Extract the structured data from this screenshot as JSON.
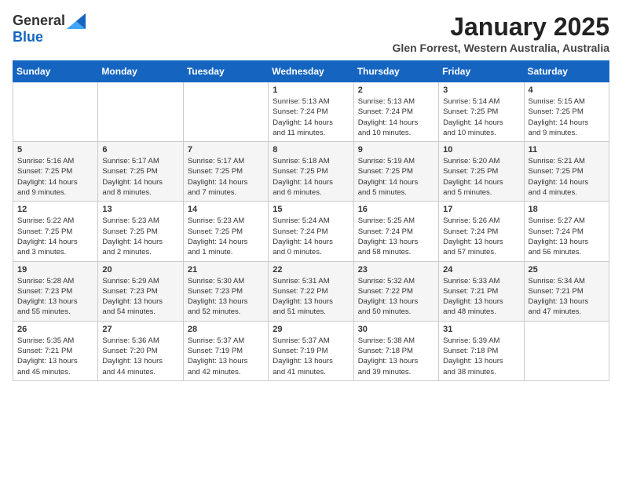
{
  "header": {
    "logo": {
      "general": "General",
      "blue": "Blue"
    },
    "title": "January 2025",
    "location": "Glen Forrest, Western Australia, Australia"
  },
  "calendar": {
    "days_of_week": [
      "Sunday",
      "Monday",
      "Tuesday",
      "Wednesday",
      "Thursday",
      "Friday",
      "Saturday"
    ],
    "weeks": [
      [
        {
          "day": "",
          "info": ""
        },
        {
          "day": "",
          "info": ""
        },
        {
          "day": "",
          "info": ""
        },
        {
          "day": "1",
          "info": "Sunrise: 5:13 AM\nSunset: 7:24 PM\nDaylight: 14 hours\nand 11 minutes."
        },
        {
          "day": "2",
          "info": "Sunrise: 5:13 AM\nSunset: 7:24 PM\nDaylight: 14 hours\nand 10 minutes."
        },
        {
          "day": "3",
          "info": "Sunrise: 5:14 AM\nSunset: 7:25 PM\nDaylight: 14 hours\nand 10 minutes."
        },
        {
          "day": "4",
          "info": "Sunrise: 5:15 AM\nSunset: 7:25 PM\nDaylight: 14 hours\nand 9 minutes."
        }
      ],
      [
        {
          "day": "5",
          "info": "Sunrise: 5:16 AM\nSunset: 7:25 PM\nDaylight: 14 hours\nand 9 minutes."
        },
        {
          "day": "6",
          "info": "Sunrise: 5:17 AM\nSunset: 7:25 PM\nDaylight: 14 hours\nand 8 minutes."
        },
        {
          "day": "7",
          "info": "Sunrise: 5:17 AM\nSunset: 7:25 PM\nDaylight: 14 hours\nand 7 minutes."
        },
        {
          "day": "8",
          "info": "Sunrise: 5:18 AM\nSunset: 7:25 PM\nDaylight: 14 hours\nand 6 minutes."
        },
        {
          "day": "9",
          "info": "Sunrise: 5:19 AM\nSunset: 7:25 PM\nDaylight: 14 hours\nand 5 minutes."
        },
        {
          "day": "10",
          "info": "Sunrise: 5:20 AM\nSunset: 7:25 PM\nDaylight: 14 hours\nand 5 minutes."
        },
        {
          "day": "11",
          "info": "Sunrise: 5:21 AM\nSunset: 7:25 PM\nDaylight: 14 hours\nand 4 minutes."
        }
      ],
      [
        {
          "day": "12",
          "info": "Sunrise: 5:22 AM\nSunset: 7:25 PM\nDaylight: 14 hours\nand 3 minutes."
        },
        {
          "day": "13",
          "info": "Sunrise: 5:23 AM\nSunset: 7:25 PM\nDaylight: 14 hours\nand 2 minutes."
        },
        {
          "day": "14",
          "info": "Sunrise: 5:23 AM\nSunset: 7:25 PM\nDaylight: 14 hours\nand 1 minute."
        },
        {
          "day": "15",
          "info": "Sunrise: 5:24 AM\nSunset: 7:24 PM\nDaylight: 14 hours\nand 0 minutes."
        },
        {
          "day": "16",
          "info": "Sunrise: 5:25 AM\nSunset: 7:24 PM\nDaylight: 13 hours\nand 58 minutes."
        },
        {
          "day": "17",
          "info": "Sunrise: 5:26 AM\nSunset: 7:24 PM\nDaylight: 13 hours\nand 57 minutes."
        },
        {
          "day": "18",
          "info": "Sunrise: 5:27 AM\nSunset: 7:24 PM\nDaylight: 13 hours\nand 56 minutes."
        }
      ],
      [
        {
          "day": "19",
          "info": "Sunrise: 5:28 AM\nSunset: 7:23 PM\nDaylight: 13 hours\nand 55 minutes."
        },
        {
          "day": "20",
          "info": "Sunrise: 5:29 AM\nSunset: 7:23 PM\nDaylight: 13 hours\nand 54 minutes."
        },
        {
          "day": "21",
          "info": "Sunrise: 5:30 AM\nSunset: 7:23 PM\nDaylight: 13 hours\nand 52 minutes."
        },
        {
          "day": "22",
          "info": "Sunrise: 5:31 AM\nSunset: 7:22 PM\nDaylight: 13 hours\nand 51 minutes."
        },
        {
          "day": "23",
          "info": "Sunrise: 5:32 AM\nSunset: 7:22 PM\nDaylight: 13 hours\nand 50 minutes."
        },
        {
          "day": "24",
          "info": "Sunrise: 5:33 AM\nSunset: 7:21 PM\nDaylight: 13 hours\nand 48 minutes."
        },
        {
          "day": "25",
          "info": "Sunrise: 5:34 AM\nSunset: 7:21 PM\nDaylight: 13 hours\nand 47 minutes."
        }
      ],
      [
        {
          "day": "26",
          "info": "Sunrise: 5:35 AM\nSunset: 7:21 PM\nDaylight: 13 hours\nand 45 minutes."
        },
        {
          "day": "27",
          "info": "Sunrise: 5:36 AM\nSunset: 7:20 PM\nDaylight: 13 hours\nand 44 minutes."
        },
        {
          "day": "28",
          "info": "Sunrise: 5:37 AM\nSunset: 7:19 PM\nDaylight: 13 hours\nand 42 minutes."
        },
        {
          "day": "29",
          "info": "Sunrise: 5:37 AM\nSunset: 7:19 PM\nDaylight: 13 hours\nand 41 minutes."
        },
        {
          "day": "30",
          "info": "Sunrise: 5:38 AM\nSunset: 7:18 PM\nDaylight: 13 hours\nand 39 minutes."
        },
        {
          "day": "31",
          "info": "Sunrise: 5:39 AM\nSunset: 7:18 PM\nDaylight: 13 hours\nand 38 minutes."
        },
        {
          "day": "",
          "info": ""
        }
      ]
    ]
  }
}
